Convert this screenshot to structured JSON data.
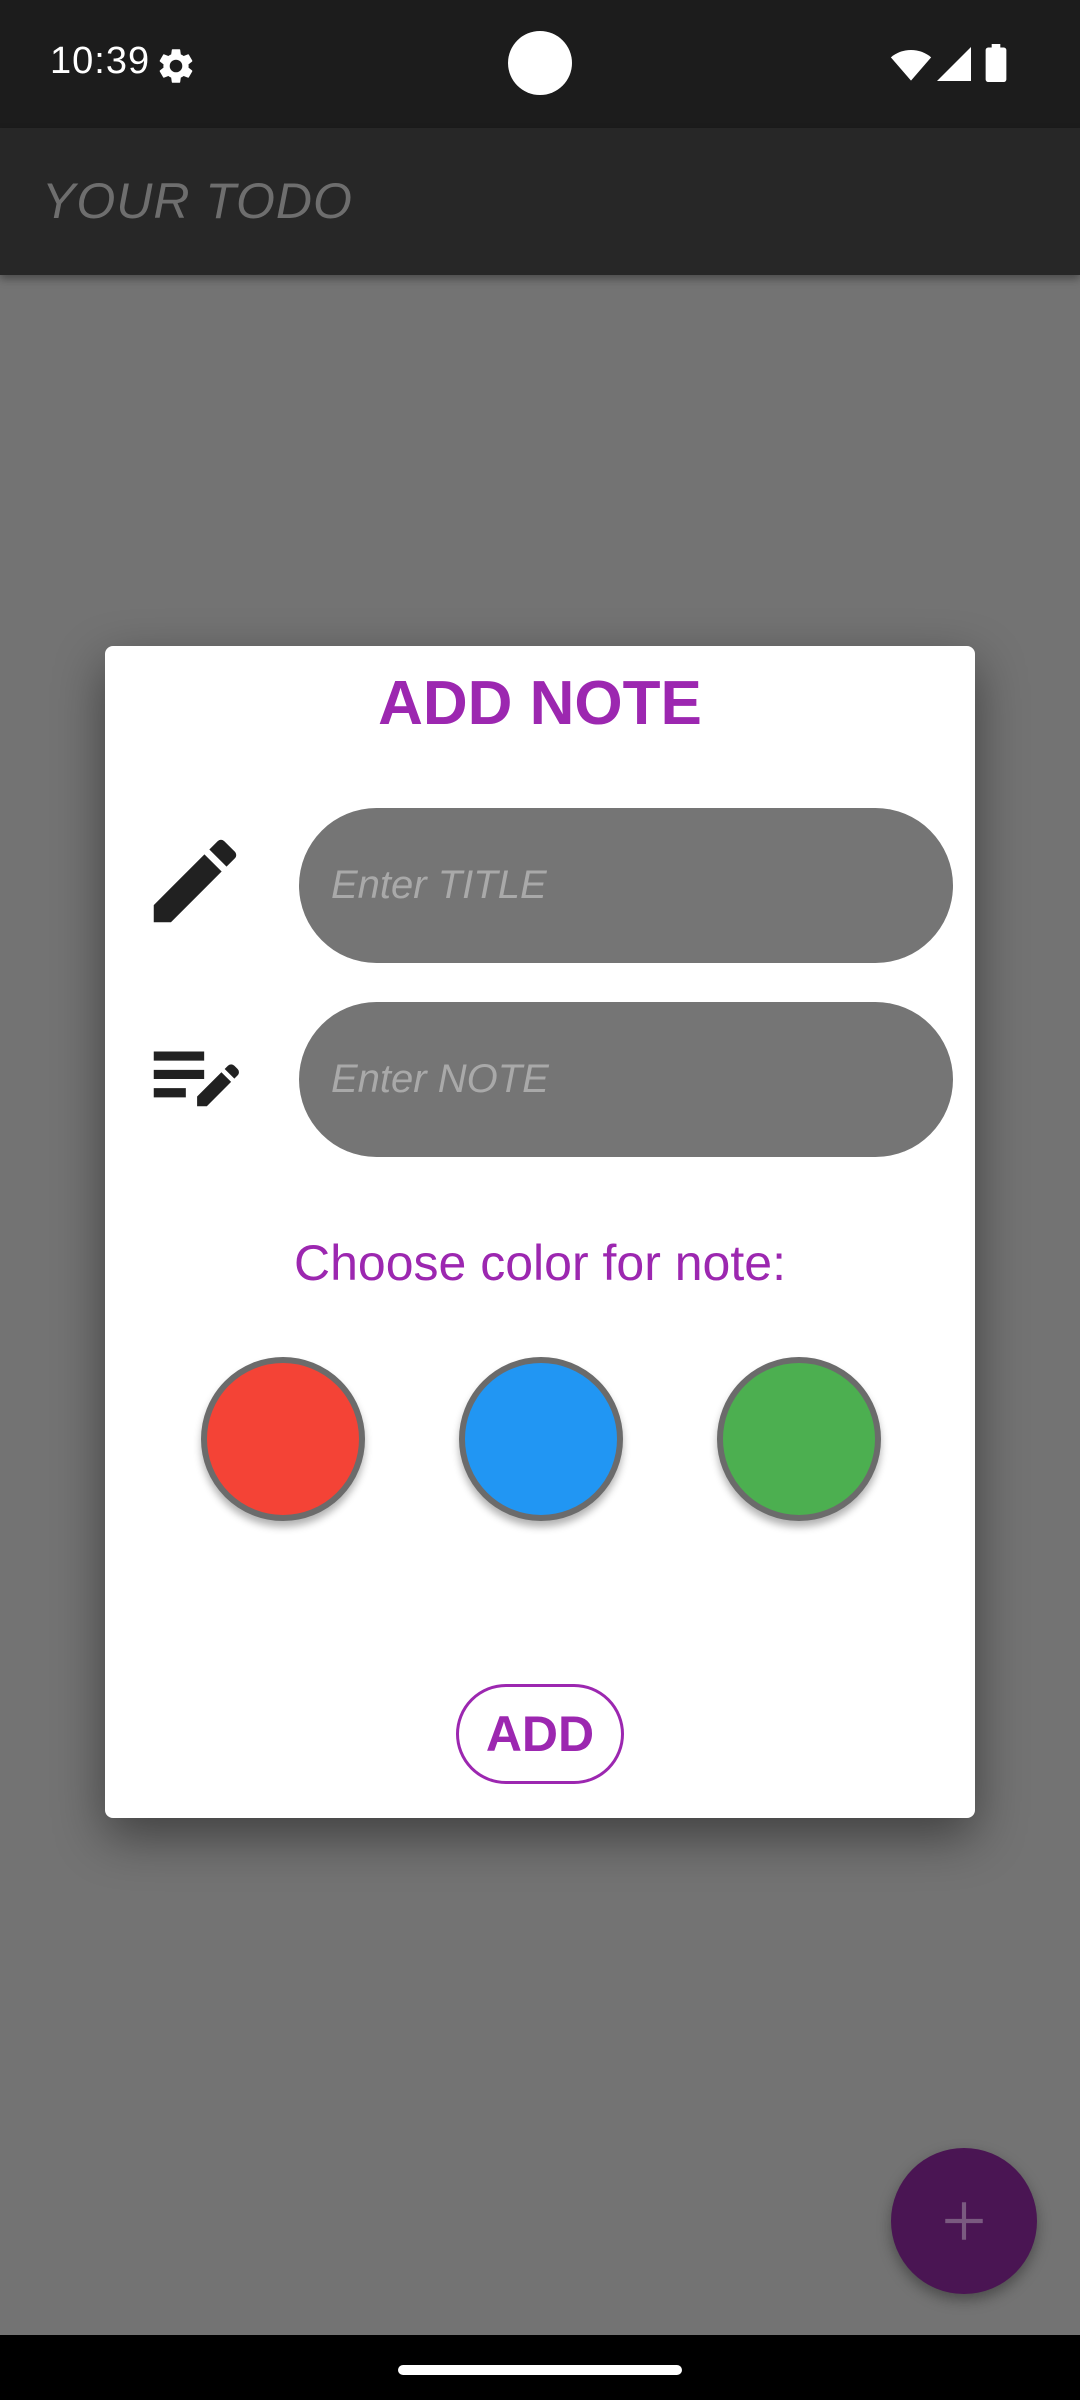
{
  "status_bar": {
    "time": "10:39",
    "icons": [
      "settings-gear-icon",
      "wifi-icon",
      "cell-signal-icon",
      "battery-icon"
    ]
  },
  "app_bar": {
    "title": "YOUR TODO"
  },
  "dialog": {
    "title": "ADD NOTE",
    "title_field": {
      "icon": "pencil-icon",
      "placeholder": "Enter TITLE",
      "value": ""
    },
    "note_field": {
      "icon": "edit-note-icon",
      "placeholder": "Enter NOTE",
      "value": ""
    },
    "color_prompt": "Choose color for note:",
    "color_options": [
      {
        "name": "red",
        "color": "#f44336"
      },
      {
        "name": "blue",
        "color": "#2196f3"
      },
      {
        "name": "green",
        "color": "#4caf50"
      }
    ],
    "add_label": "ADD"
  },
  "fab": {
    "icon": "plus-icon"
  },
  "colors": {
    "accent": "#9c27b0",
    "fab": "#4a1553",
    "scrim_background": "#737373",
    "input_background": "#757575"
  }
}
